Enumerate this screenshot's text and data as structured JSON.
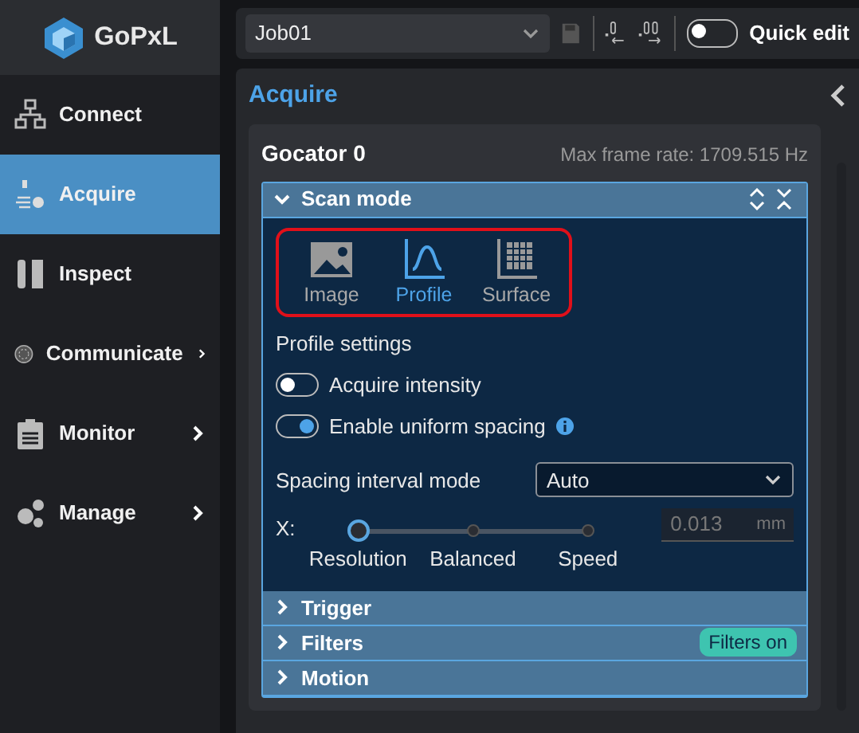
{
  "app": {
    "name": "GoPxL"
  },
  "sidebar": {
    "items": [
      {
        "label": "Connect",
        "selected": false,
        "has_submenu": false
      },
      {
        "label": "Acquire",
        "selected": true,
        "has_submenu": false
      },
      {
        "label": "Inspect",
        "selected": false,
        "has_submenu": false
      },
      {
        "label": "Communicate",
        "selected": false,
        "has_submenu": true
      },
      {
        "label": "Monitor",
        "selected": false,
        "has_submenu": true
      },
      {
        "label": "Manage",
        "selected": false,
        "has_submenu": true
      }
    ]
  },
  "toolbar": {
    "job": "Job01",
    "quick_edit": {
      "label": "Quick edit",
      "on": false
    }
  },
  "panel": {
    "title": "Acquire",
    "sensor": {
      "name": "Gocator 0",
      "frame_rate": "Max frame rate: 1709.515 Hz"
    },
    "sections": [
      {
        "title": "Scan mode",
        "expanded": true,
        "content": {
          "scan_modes": [
            {
              "label": "Image",
              "selected": false
            },
            {
              "label": "Profile",
              "selected": true
            },
            {
              "label": "Surface",
              "selected": false
            }
          ],
          "settings_title": "Profile settings",
          "toggles": [
            {
              "label": "Acquire intensity",
              "on": false,
              "info": false
            },
            {
              "label": "Enable uniform spacing",
              "on": true,
              "info": true
            }
          ],
          "spacing_mode": {
            "label": "Spacing interval mode",
            "value": "Auto"
          },
          "slider": {
            "axis": "X:",
            "stops": [
              "Resolution",
              "Balanced",
              "Speed"
            ],
            "level": 0
          },
          "spacing_value": {
            "value": "0.013",
            "unit": "mm"
          }
        }
      },
      {
        "title": "Trigger",
        "expanded": false
      },
      {
        "title": "Filters",
        "expanded": false,
        "badge": "Filters on"
      },
      {
        "title": "Motion",
        "expanded": false
      }
    ]
  }
}
